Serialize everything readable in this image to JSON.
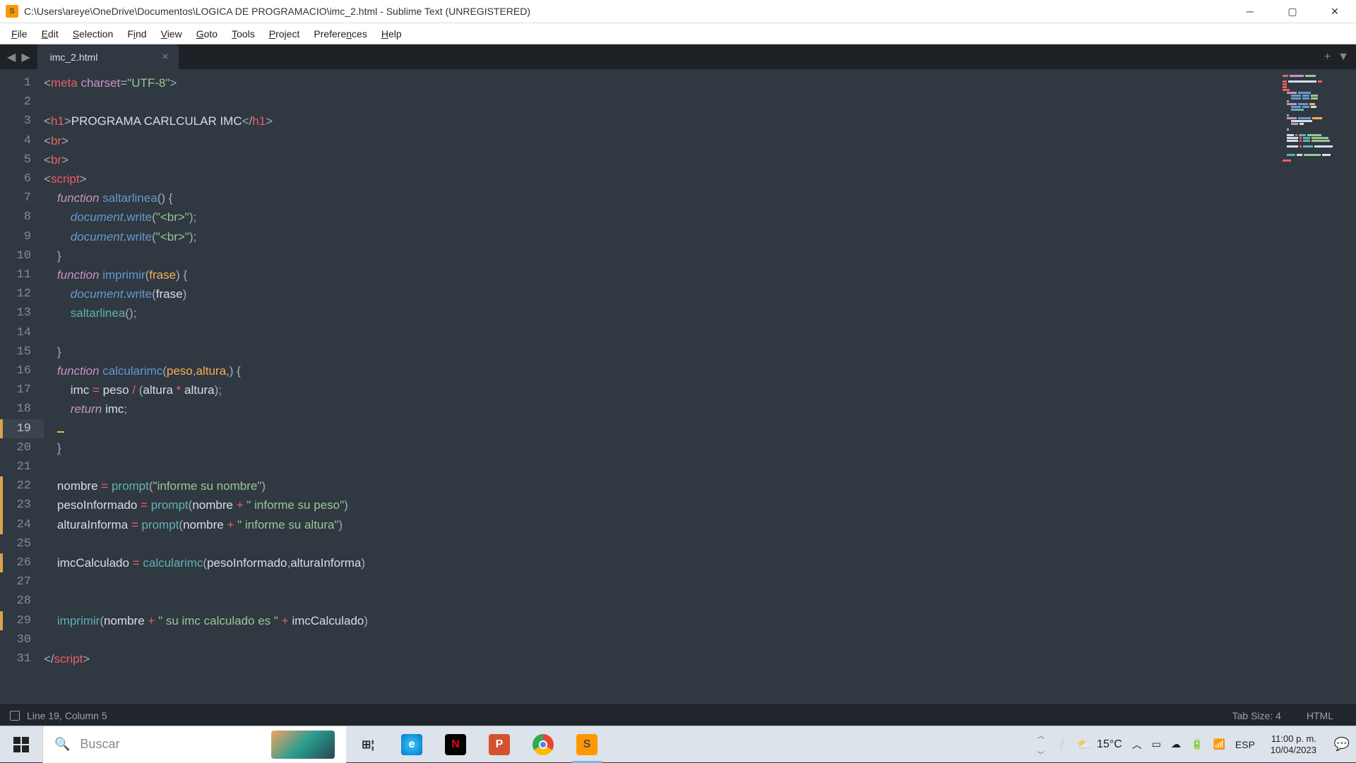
{
  "title_bar": {
    "path": "C:\\Users\\areye\\OneDrive\\Documentos\\LOGICA DE PROGRAMACIO\\imc_2.html - Sublime Text (UNREGISTERED)"
  },
  "menu": {
    "file": "File",
    "edit": "Edit",
    "selection": "Selection",
    "find": "Find",
    "view": "View",
    "goto": "Goto",
    "tools": "Tools",
    "project": "Project",
    "preferences": "Preferences",
    "help": "Help"
  },
  "tab": {
    "name": "imc_2.html"
  },
  "status": {
    "position": "Line 19, Column 5",
    "tab_size": "Tab Size: 4",
    "syntax": "HTML"
  },
  "taskbar": {
    "search_placeholder": "Buscar",
    "weather_temp": "15°C",
    "lang": "ESP",
    "time": "11:00 p. m.",
    "date": "10/04/2023"
  },
  "code": {
    "total_lines": 31,
    "current_line": 19,
    "modified_lines": [
      19,
      22,
      23,
      24,
      26,
      29
    ]
  }
}
